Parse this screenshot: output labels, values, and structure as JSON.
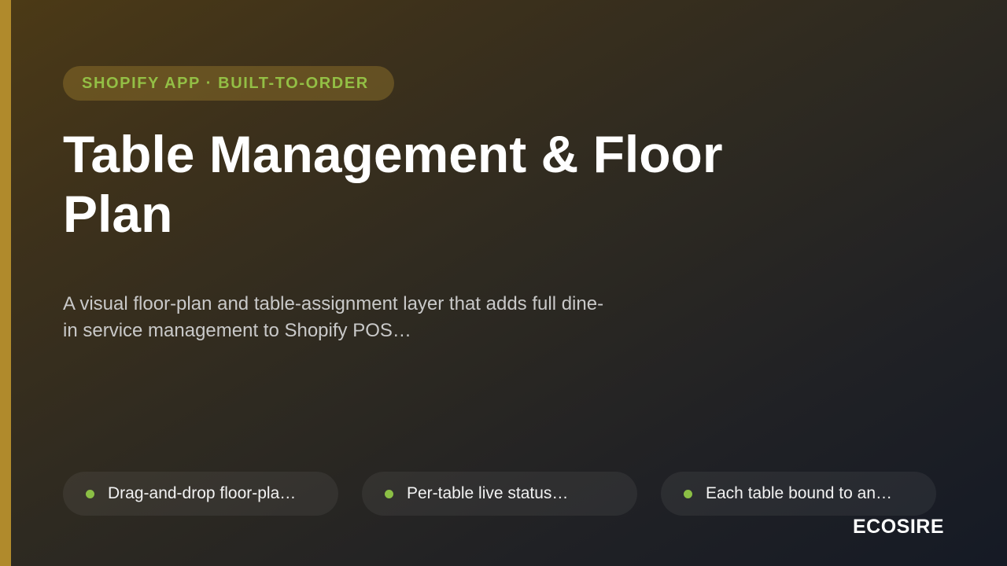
{
  "eyebrow": "SHOPIFY APP · BUILT-TO-ORDER",
  "title": "Table Management & Floor Plan",
  "subtitle": "A visual floor-plan and table-assignment layer that adds full dine-in service management to Shopify POS…",
  "features": [
    {
      "label": "Drag-and-drop floor-pla…"
    },
    {
      "label": "Per-table live status…"
    },
    {
      "label": "Each table bound to an…"
    }
  ],
  "brand": "ECOSIRE",
  "colors": {
    "accent_bar": "#b08a2c",
    "eyebrow_text": "#93bf45",
    "feature_dot": "#8bbf45"
  }
}
